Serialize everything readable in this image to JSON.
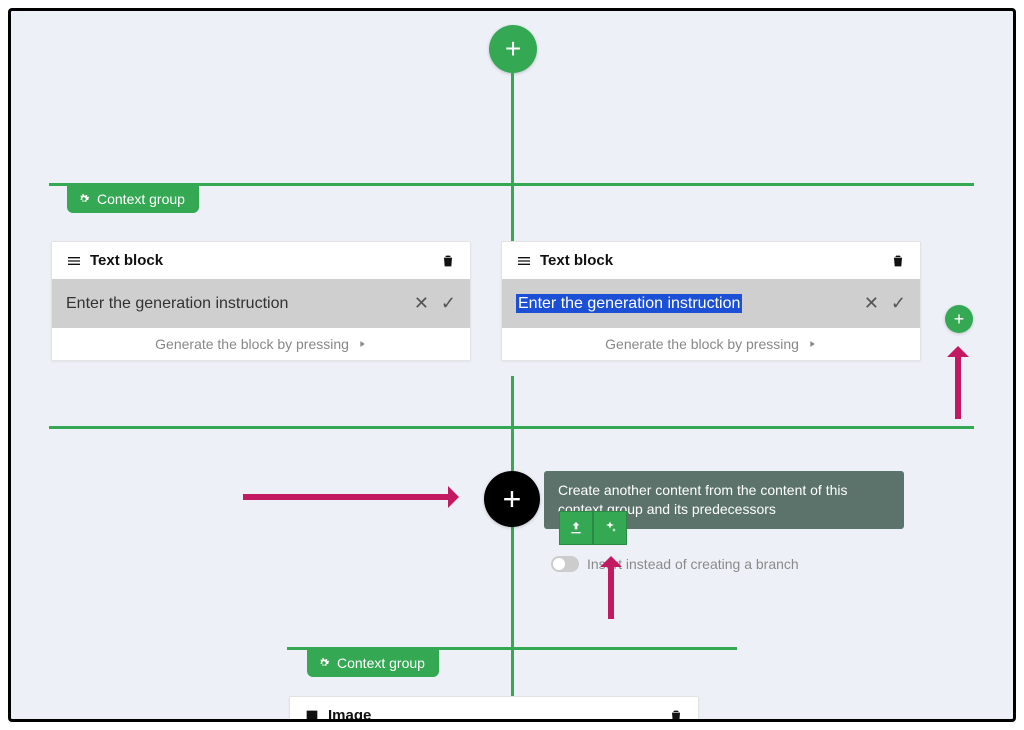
{
  "colors": {
    "accent": "#34a853",
    "annotation": "#c31862",
    "selection": "#1a4fd6"
  },
  "top": {
    "add": "+"
  },
  "group1": {
    "label": "Context group",
    "blocks": [
      {
        "title": "Text block",
        "placeholder": "Enter the generation instruction",
        "footer_prefix": "Generate the block by pressing",
        "selected": false
      },
      {
        "title": "Text block",
        "placeholder": "Enter the generation instruction",
        "footer_prefix": "Generate the block by pressing",
        "selected": true
      }
    ]
  },
  "side_add": "+",
  "center_add": "+",
  "popover": {
    "text": "Create another content from the content of this context group and its predecessors"
  },
  "toggle": {
    "label": "Insert instead of creating a branch",
    "on": false
  },
  "group2": {
    "label": "Context group",
    "block": {
      "title": "Image"
    }
  }
}
